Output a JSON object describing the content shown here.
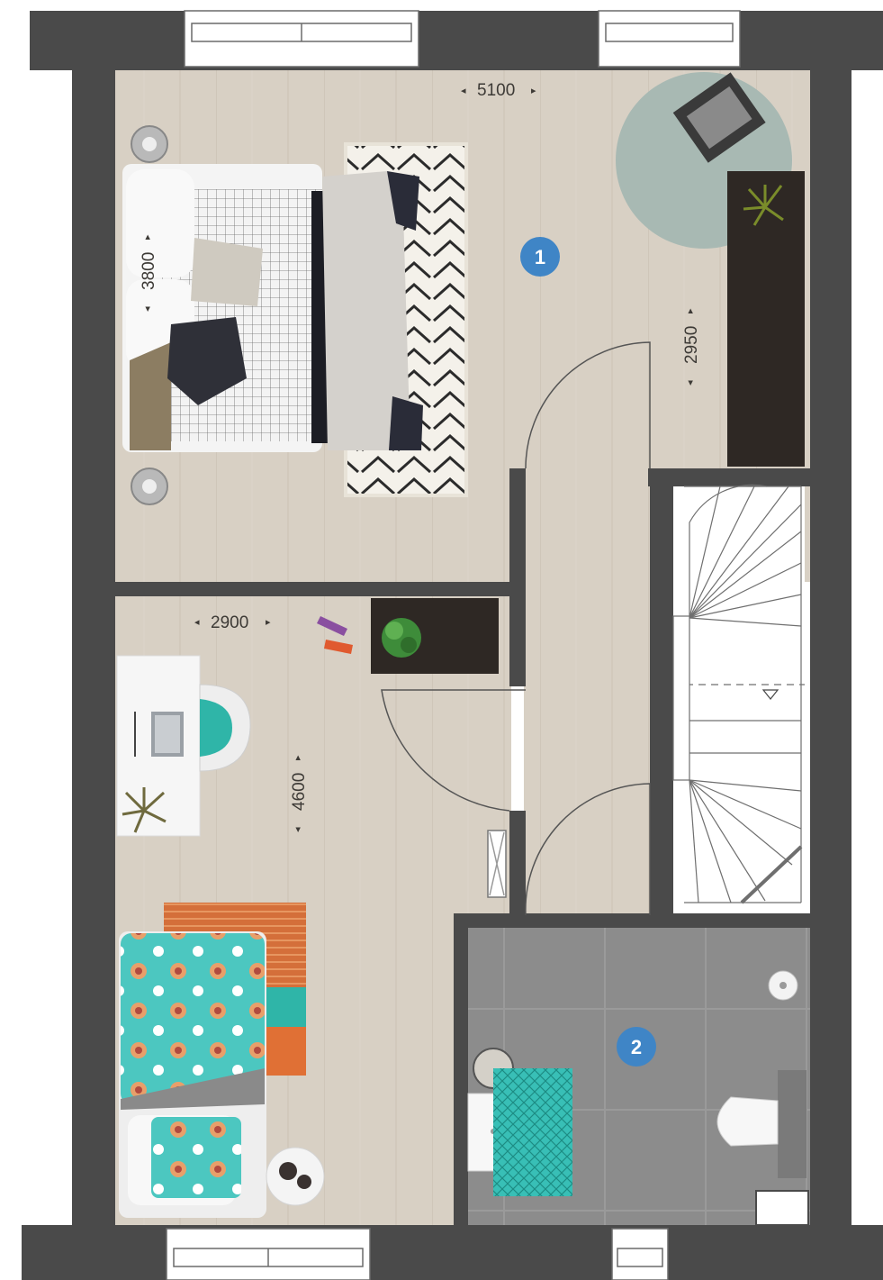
{
  "floorplan": {
    "room_markers": [
      {
        "number": "1"
      },
      {
        "number": "2"
      }
    ],
    "dimensions": {
      "bedroom1_width": "5100",
      "bedroom1_depth": "3800",
      "bedroom1_wall": "2950",
      "bedroom2_width": "2900",
      "bedroom2_depth": "4600"
    }
  },
  "colors": {
    "wall": "#4a4a4a",
    "wood_floor": "#d8d0c4",
    "bathroom_tile": "#8c8c8c",
    "marker": "#3f85c6",
    "dark_cabinet": "#2e2824",
    "rug_teal": "#2fb5a8",
    "rug_orange": "#e07035"
  }
}
